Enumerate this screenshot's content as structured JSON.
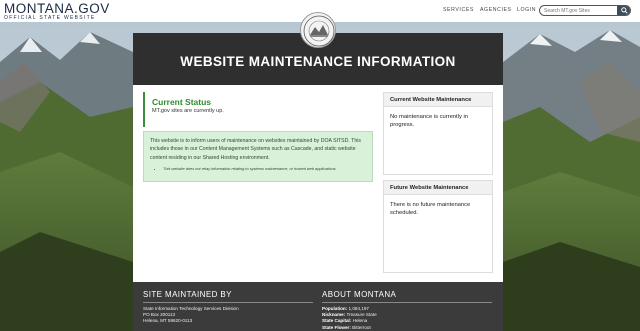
{
  "header": {
    "logo_title": "MONTANA.GOV",
    "logo_subtitle": "OFFICIAL STATE WEBSITE",
    "nav": {
      "services": "SERVICES",
      "agencies": "AGENCIES",
      "login": "LOGIN"
    },
    "search_placeholder": "Search MT.gov Sites",
    "search_icon": "search-icon"
  },
  "page_title": "WEBSITE MAINTENANCE INFORMATION",
  "status": {
    "heading": "Current Status",
    "text": "MT.gov sites are currently up."
  },
  "info": {
    "text": "This website is to inform users of maintenance on websites maintained by DOA SITSD. This includes those in our Content Management Systems such as Cascade, and static website content residing in our Shared Hosting environment.",
    "note": "This website does not relay information relating to systems maintenance, or hosted web applications."
  },
  "current_maintenance": {
    "heading": "Current Website Maintenance",
    "text": "No maintenance is currently in progress."
  },
  "future_maintenance": {
    "heading": "Future Website Maintenance",
    "text": "There is no future maintenance scheduled."
  },
  "footer": {
    "site_heading": "SITE MAINTAINED BY",
    "site_lines": [
      "State Information Technology Services Division",
      "PO Box 200113",
      "Helena, MT 59620-0113"
    ],
    "about_heading": "ABOUT MONTANA",
    "about": [
      {
        "label": "Population:",
        "value": "1,084,197"
      },
      {
        "label": "Nickname:",
        "value": "Treasure State"
      },
      {
        "label": "State Capital:",
        "value": "Helena"
      },
      {
        "label": "State Flower:",
        "value": "Bitterroot"
      }
    ]
  },
  "colors": {
    "accent_green": "#2e8b2e",
    "banner_dark": "#2f2f2f",
    "footer_dark": "#3b3b3b"
  }
}
